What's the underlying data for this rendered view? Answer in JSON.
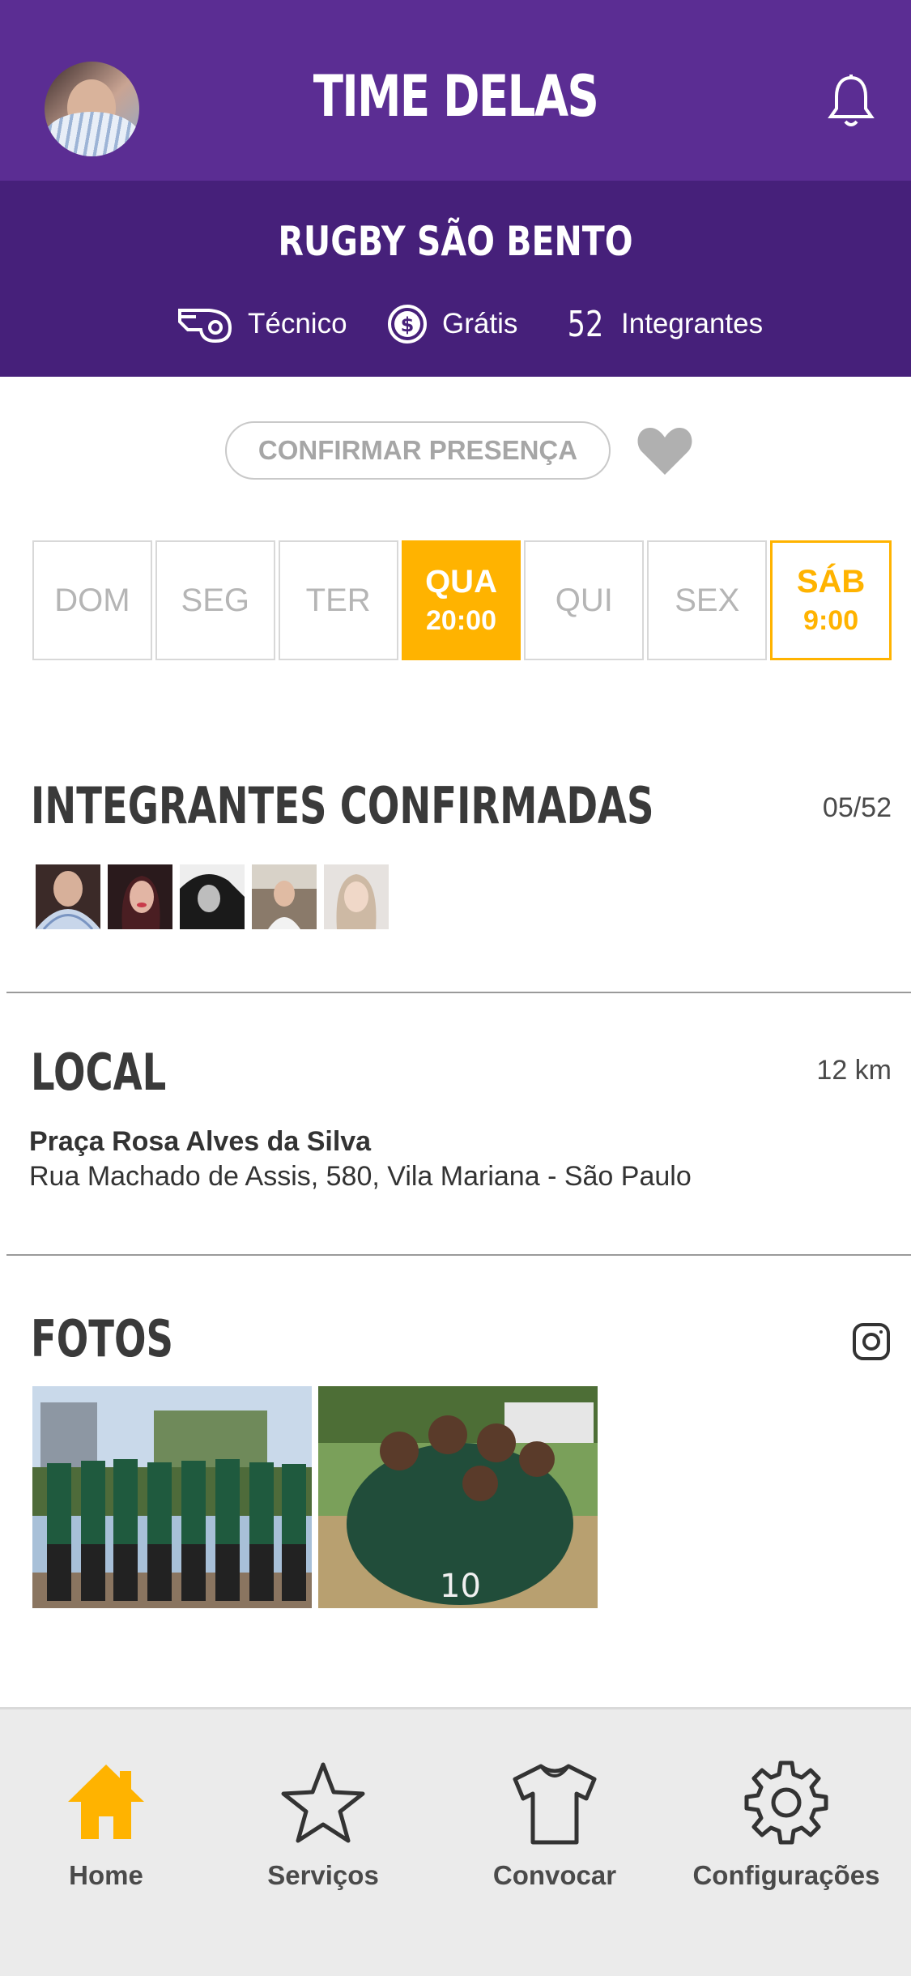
{
  "header": {
    "title": "TIME DELAS"
  },
  "team": {
    "name": "RUGBY SÃO BENTO",
    "coach_label": "Técnico",
    "price_label": "Grátis",
    "members_count": "52",
    "members_label": "Integrantes"
  },
  "actions": {
    "confirm_label": "CONFIRMAR PRESENÇA"
  },
  "days": [
    {
      "label": "DOM",
      "time": "",
      "state": "none"
    },
    {
      "label": "SEG",
      "time": "",
      "state": "none"
    },
    {
      "label": "TER",
      "time": "",
      "state": "none"
    },
    {
      "label": "QUA",
      "time": "20:00",
      "state": "selected"
    },
    {
      "label": "QUI",
      "time": "",
      "state": "none"
    },
    {
      "label": "SEX",
      "time": "",
      "state": "none"
    },
    {
      "label": "SÁB",
      "time": "9:00",
      "state": "scheduled"
    }
  ],
  "confirmed": {
    "title": "INTEGRANTES CONFIRMADAS",
    "count": "05/52"
  },
  "location": {
    "title": "LOCAL",
    "distance": "12 km",
    "name": "Praça Rosa Alves da Silva",
    "address": "Rua Machado de Assis, 580, Vila Mariana - São Paulo"
  },
  "photos": {
    "title": "FOTOS"
  },
  "tabbar": {
    "home": "Home",
    "services": "Serviços",
    "call": "Convocar",
    "settings": "Configurações"
  },
  "colors": {
    "primary": "#5b2d93",
    "primary_dark": "#46207a",
    "accent": "#ffb300"
  }
}
